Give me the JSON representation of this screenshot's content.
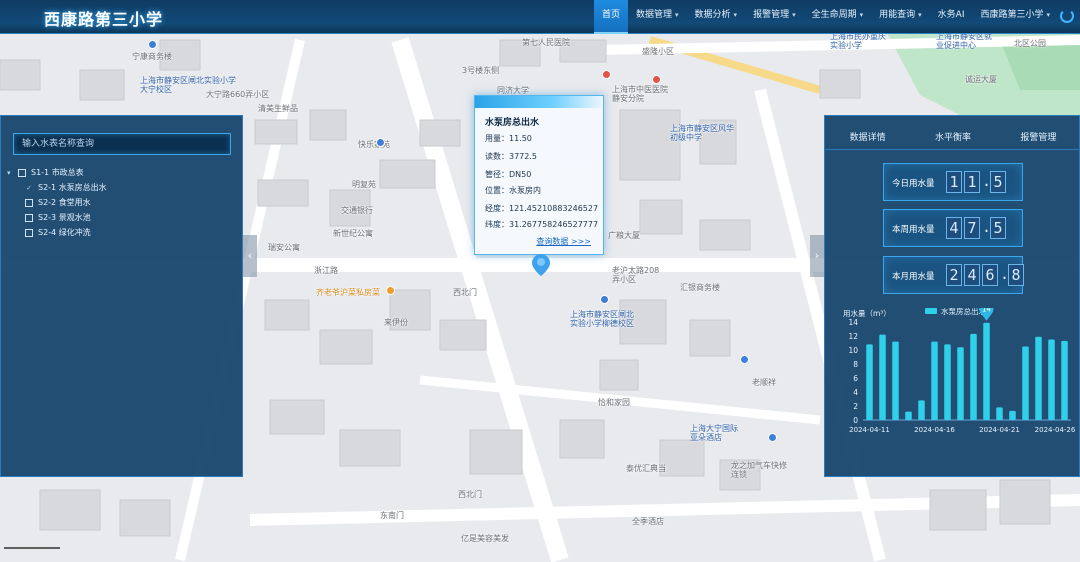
{
  "header": {
    "title": "西康路第三小学",
    "nav": [
      {
        "label": "首页",
        "active": true,
        "caret": false
      },
      {
        "label": "数据管理",
        "active": false,
        "caret": true
      },
      {
        "label": "数据分析",
        "active": false,
        "caret": true
      },
      {
        "label": "报警管理",
        "active": false,
        "caret": true
      },
      {
        "label": "全生命周期",
        "active": false,
        "caret": true
      },
      {
        "label": "用能查询",
        "active": false,
        "caret": true
      },
      {
        "label": "水务AI",
        "active": false,
        "caret": false
      },
      {
        "label": "西康路第三小学",
        "active": false,
        "caret": true
      }
    ]
  },
  "left_panel": {
    "search_placeholder": "输入水表名称查询",
    "tree": [
      {
        "label": "S1-1 市政总表",
        "level": 0,
        "checked": false,
        "expanded": true
      },
      {
        "label": "S2-1 水泵房总出水",
        "level": 1,
        "checked": true
      },
      {
        "label": "S2-2 食堂用水",
        "level": 1,
        "checked": false
      },
      {
        "label": "S2-3 景观水池",
        "level": 1,
        "checked": false
      },
      {
        "label": "S2-4 绿化冲洗",
        "level": 1,
        "checked": false
      }
    ]
  },
  "popup": {
    "title": "水泵房总出水",
    "lines": [
      "用量：11.50",
      "读数：3772.5",
      "管径：DN50",
      "位置：水泵房内",
      "经度：121.45210883246527",
      "纬度：31.267758246527777"
    ],
    "link": "查询数据 >>>"
  },
  "right_panel": {
    "tabs": [
      "数据详情",
      "水平衡率",
      "报警管理"
    ],
    "meters": [
      {
        "label": "今日用水量",
        "digits": "11.5"
      },
      {
        "label": "本周用水量",
        "digits": "47.5"
      },
      {
        "label": "本月用水量",
        "digits": "246.8"
      }
    ]
  },
  "map_labels": [
    {
      "text": "宁康商务楼",
      "cls": ""
    },
    {
      "text": "上海市静安区闸北实验小学大宁校区",
      "cls": "poi"
    },
    {
      "text": "大宁路660弄小区",
      "cls": ""
    },
    {
      "text": "清美生鲜品",
      "cls": ""
    },
    {
      "text": "第七人民医院",
      "cls": ""
    },
    {
      "text": "同济大学",
      "cls": ""
    },
    {
      "text": "3号楼东侧",
      "cls": ""
    },
    {
      "text": "上海市中医医院静安分院",
      "cls": ""
    },
    {
      "text": "快乐家苑",
      "cls": ""
    },
    {
      "text": "明复苑",
      "cls": ""
    },
    {
      "text": "交通银行",
      "cls": ""
    },
    {
      "text": "新世纪公寓",
      "cls": ""
    },
    {
      "text": "瑞安公寓",
      "cls": ""
    },
    {
      "text": "浙江路",
      "cls": ""
    },
    {
      "text": "齐老爷沪菜私房菜",
      "cls": "food"
    },
    {
      "text": "来伊份",
      "cls": ""
    },
    {
      "text": "西北门",
      "cls": ""
    },
    {
      "text": "上海市静安区风华初级中学",
      "cls": "poi"
    },
    {
      "text": "上海市静安区闸北实验小学柳德校区",
      "cls": "poi"
    },
    {
      "text": "老沪太路208弄小区",
      "cls": ""
    },
    {
      "text": "汇银商务楼",
      "cls": ""
    },
    {
      "text": "广粮大厦",
      "cls": ""
    },
    {
      "text": "老顺祥",
      "cls": ""
    },
    {
      "text": "恰和家园",
      "cls": ""
    },
    {
      "text": "上海大宁国际亚朵酒店",
      "cls": "poi"
    },
    {
      "text": "泰优汇典当",
      "cls": ""
    },
    {
      "text": "龙之加气车快修连锁",
      "cls": ""
    },
    {
      "text": "全季酒店",
      "cls": ""
    },
    {
      "text": "亿是美容美发",
      "cls": ""
    },
    {
      "text": "西北门",
      "cls": ""
    },
    {
      "text": "东南门",
      "cls": ""
    },
    {
      "text": "盛隆小区",
      "cls": ""
    },
    {
      "text": "上海市民办重庆实验小学",
      "cls": "poi"
    },
    {
      "text": "上海市静安区就业促进中心",
      "cls": "poi"
    },
    {
      "text": "北区公园",
      "cls": ""
    },
    {
      "text": "诚运大厦",
      "cls": ""
    }
  ],
  "chart_data": {
    "type": "bar",
    "ylabel": "用水量（m³）",
    "legend": "水泵房总出水",
    "legend_position": "top",
    "ylim": [
      0,
      14
    ],
    "yticks": [
      0,
      2,
      4,
      6,
      8,
      10,
      12,
      14
    ],
    "x_tick_labels": [
      "2024-04-11",
      "2024-04-16",
      "2024-04-21",
      "2024-04-26"
    ],
    "categories": [
      "2024-04-11",
      "2024-04-12",
      "2024-04-13",
      "2024-04-14",
      "2024-04-15",
      "2024-04-16",
      "2024-04-17",
      "2024-04-18",
      "2024-04-19",
      "2024-04-20",
      "2024-04-21",
      "2024-04-22",
      "2024-04-23",
      "2024-04-24",
      "2024-04-25",
      "2024-04-26"
    ],
    "values": [
      10.8,
      12.2,
      11.2,
      1.2,
      2.8,
      11.2,
      10.8,
      10.4,
      12.3,
      13.9,
      1.8,
      1.3,
      10.5,
      11.9,
      11.5,
      11.3
    ],
    "highlight_index": 9,
    "highlight_label": "14",
    "bar_color": "#2fd0ea"
  }
}
